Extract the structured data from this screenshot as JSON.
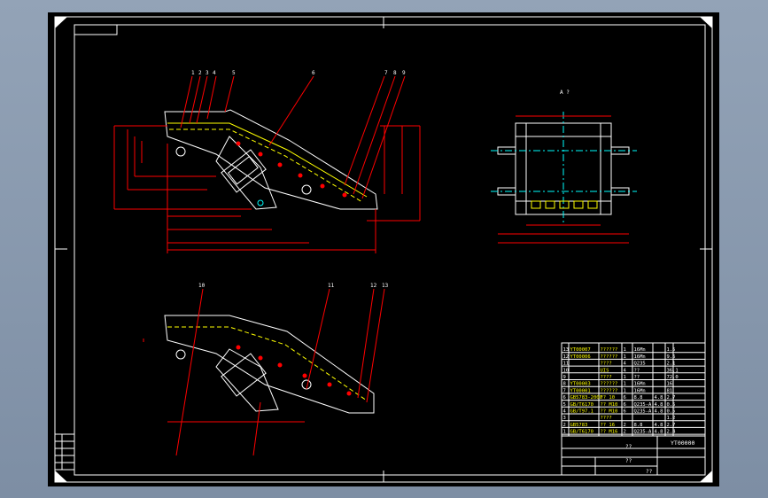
{
  "drawing": {
    "part_number_title": "YT00000",
    "block_name_1": "??",
    "block_name_2": "??",
    "block_scale_note": "??",
    "view_label_a": "A ?"
  },
  "callouts_top": [
    "1",
    "2",
    "3",
    "4",
    "5",
    "6",
    "7",
    "8",
    "9"
  ],
  "callouts_bottom": [
    "10",
    "11",
    "12",
    "13"
  ],
  "bom_rows": [
    [
      "13",
      "YT00007",
      "??????",
      "1",
      "16Mn",
      "",
      "1.5"
    ],
    [
      "12",
      "YT00006",
      "??????",
      "1",
      "16Mn",
      "",
      "9.6"
    ],
    [
      "11",
      "",
      "????",
      "4",
      "Q235",
      "",
      "2.1"
    ],
    [
      "10",
      "",
      "UIS",
      "4",
      "??",
      "",
      "36.1"
    ],
    [
      "9",
      "",
      "????",
      "1",
      "??",
      "",
      "72.0"
    ],
    [
      "8",
      "YT00003",
      "??????",
      "1",
      "16Mn",
      "",
      "16"
    ],
    [
      "7",
      "YT00001",
      "??????",
      "1",
      "16Mn",
      "",
      "81"
    ],
    [
      "6",
      "GB5783-2000",
      "?? 10",
      "6",
      "8.8",
      "4.8",
      "2.7"
    ],
    [
      "5",
      "GB/T6170",
      "?? M10",
      "6",
      "Q235-A",
      "4.8",
      "0.5"
    ],
    [
      "4",
      "GB/T97.1",
      "?? M10",
      "6",
      "Q235-A",
      "4.8",
      "0.5"
    ],
    [
      "3",
      "",
      "????",
      "",
      "",
      "",
      "1.2"
    ],
    [
      "2",
      "GB5783",
      "?? 16",
      "2",
      "8.8",
      "4.8",
      "2.7"
    ],
    [
      "1",
      "GB/T6170",
      "?? M16",
      "2",
      "Q235-A",
      "4.8",
      "2.4"
    ]
  ]
}
